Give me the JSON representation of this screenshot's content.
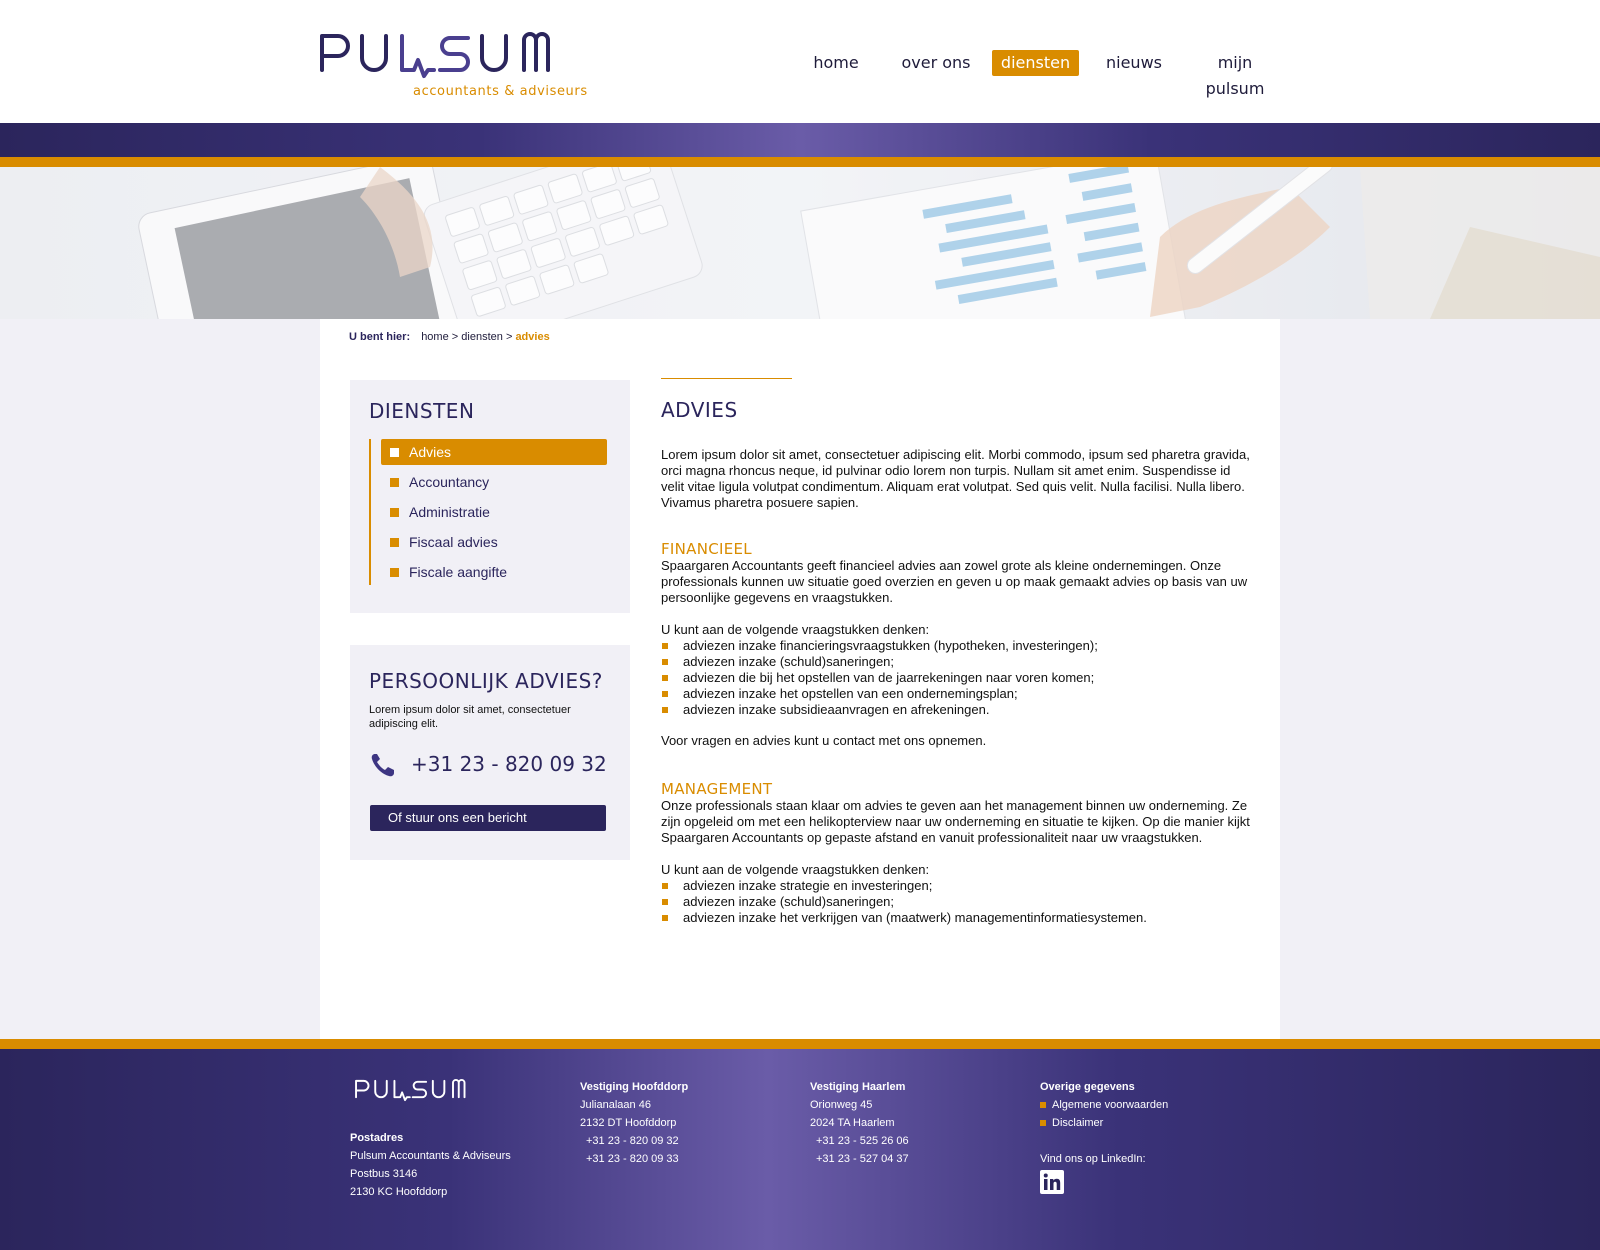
{
  "header": {
    "logo_text": "PULSUM",
    "logo_subtitle": "accountants & adviseurs",
    "nav": [
      {
        "label": "home",
        "active": false
      },
      {
        "label": "over ons",
        "active": false
      },
      {
        "label": "diensten",
        "active": true
      },
      {
        "label": "nieuws",
        "active": false
      },
      {
        "label": "mijn pulsum",
        "active": false
      }
    ]
  },
  "colors": {
    "brand_purple": "#2b255c",
    "accent_orange": "#d98c00",
    "footer_gradient_center": "#6a5ca8"
  },
  "breadcrumb": {
    "label": "U bent hier:",
    "items": [
      "home",
      "diensten",
      "advies"
    ],
    "separator": ">"
  },
  "sidebar": {
    "services": {
      "title": "DIENSTEN",
      "items": [
        {
          "label": "Advies",
          "active": true
        },
        {
          "label": "Accountancy",
          "active": false
        },
        {
          "label": "Administratie",
          "active": false
        },
        {
          "label": "Fiscaal advies",
          "active": false
        },
        {
          "label": "Fiscale aangifte",
          "active": false
        }
      ]
    },
    "contact": {
      "title": "PERSOONLIJK ADVIES?",
      "text": "Lorem ipsum dolor sit amet, consectetuer adipiscing elit.",
      "phone_icon": "phone-icon",
      "phone": "+31 23 - 820 09 32",
      "button": "Of stuur ons een bericht"
    }
  },
  "main": {
    "title": "ADVIES",
    "intro": "Lorem ipsum dolor sit amet, consectetuer adipiscing elit. Morbi commodo, ipsum sed pharetra gravida, orci magna rhoncus neque, id pulvinar odio lorem non turpis. Nullam sit amet enim. Suspendisse id velit vitae ligula volutpat condimentum. Aliquam erat volutpat. Sed quis velit. Nulla facilisi. Nulla libero. Vivamus pharetra posuere sapien.",
    "sections": [
      {
        "title": "FINANCIEEL",
        "body": "Spaargaren Accountants geeft financieel advies aan zowel grote als kleine ondernemingen. Onze professionals kunnen uw situatie goed overzien en geven u op maak gemaakt advies op basis van uw persoonlijke gegevens en vraagstukken.",
        "list_intro": "U kunt aan de volgende vraagstukken denken:",
        "items": [
          "adviezen inzake financieringsvraagstukken (hypotheken, investeringen);",
          "adviezen inzake (schuld)saneringen;",
          "adviezen die bij het opstellen van de jaarrekeningen naar voren komen;",
          "adviezen inzake het opstellen van een ondernemingsplan;",
          "adviezen inzake subsidieaanvragen en afrekeningen."
        ],
        "outro": "Voor vragen en advies kunt u contact met ons opnemen."
      },
      {
        "title": "MANAGEMENT",
        "body": "Onze professionals staan klaar om advies te geven aan het management binnen uw onderneming. Ze zijn opgeleid om met een helikopterview naar uw onderneming en situatie te kijken. Op die manier kijkt Spaargaren Accountants op gepaste afstand en vanuit professionaliteit naar uw vraagstukken.",
        "list_intro": "U kunt aan de volgende vraagstukken denken:",
        "items": [
          "adviezen inzake strategie en investeringen;",
          "adviezen inzake (schuld)saneringen;",
          "adviezen inzake het verkrijgen van (maatwerk) managementinformatiesystemen."
        ]
      }
    ]
  },
  "footer": {
    "logo_text": "PULSUM",
    "postadres": {
      "heading": "Postadres",
      "lines": [
        "Pulsum Accountants & Adviseurs",
        "Postbus 3146",
        "2130 KC Hoofddorp"
      ]
    },
    "hoofddorp": {
      "heading": "Vestiging Hoofddorp",
      "lines": [
        "Julianalaan 46",
        "2132 DT  Hoofddorp",
        "+31 23 - 820 09 32",
        "+31 23 - 820 09 33"
      ]
    },
    "haarlem": {
      "heading": "Vestiging Haarlem",
      "lines": [
        "Orionweg 45",
        "2024 TA  Haarlem",
        "+31 23 - 525 26 06",
        "+31 23 - 527 04 37"
      ]
    },
    "overige": {
      "heading": "Overige gegevens",
      "links": [
        "Algemene voorwaarden",
        "Disclaimer"
      ],
      "linkedin_label": "Vind ons op LinkedIn:",
      "linkedin_icon": "linkedin-icon"
    }
  }
}
